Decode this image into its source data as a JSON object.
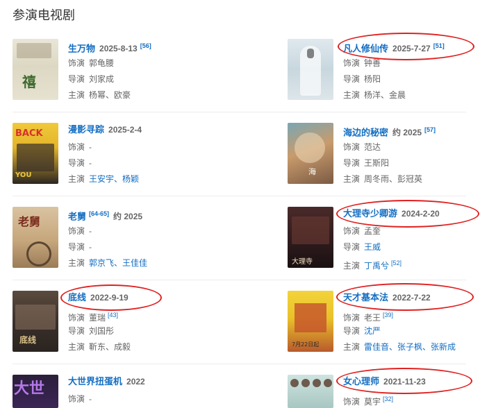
{
  "page": {
    "section_title": "参演电视剧"
  },
  "labels": {
    "role": "饰演",
    "director": "导演",
    "starring": "主演"
  },
  "items": [
    {
      "title": "生万物",
      "date": "2025-8-13",
      "cite": "[56]",
      "role": "郭龟腰",
      "director": "刘家成",
      "starring": "杨幂、欧豪",
      "starring_link": false
    },
    {
      "title": "凡人修仙传",
      "date": "2025-7-27",
      "cite": "[51]",
      "role": "钟善",
      "director": "杨阳",
      "starring": "杨洋、金晨",
      "starring_link": false
    },
    {
      "title": "漫影寻踪",
      "date": "2025-2-4",
      "cite": "",
      "role": "-",
      "director": "-",
      "starring": "王安宇、杨颖",
      "starring_link": true
    },
    {
      "title": "海边的秘密",
      "date": "约 2025",
      "cite": "[57]",
      "role": "范达",
      "director": "王斯阳",
      "starring": "周冬雨、彭冠英",
      "starring_link": false
    },
    {
      "title": "老舅",
      "date": "约 2025",
      "cite": "[64-65]",
      "role": "-",
      "director": "-",
      "starring": "郭京飞、王佳佳",
      "starring_link": true
    },
    {
      "title": "大理寺少卿游",
      "date": "2024-2-20",
      "cite": "",
      "role": "孟奎",
      "director": "王威",
      "director_link": true,
      "starring": "丁禹兮",
      "starring_link": true,
      "starring_sup": "[52]"
    },
    {
      "title": "底线",
      "date": "2022-9-19",
      "cite": "",
      "role": "董瑞",
      "role_sup": "[43]",
      "director": "刘国彤",
      "starring": "靳东、成毅",
      "starring_link": false
    },
    {
      "title": "天才基本法",
      "date": "2022-7-22",
      "cite": "",
      "role": "老王",
      "role_sup": "[39]",
      "director": "沈严",
      "director_link": true,
      "starring": "雷佳音、张子枫、张新成",
      "starring_link": true
    },
    {
      "title": "大世界扭蛋机",
      "date": "2022",
      "cite": "",
      "role": "-"
    },
    {
      "title": "女心理师",
      "date": "2021-11-23",
      "cite": "",
      "role": "莫宇",
      "role_sup": "[32]"
    }
  ],
  "colors": {
    "link": "#136ec2",
    "highlight": "#e02020"
  }
}
